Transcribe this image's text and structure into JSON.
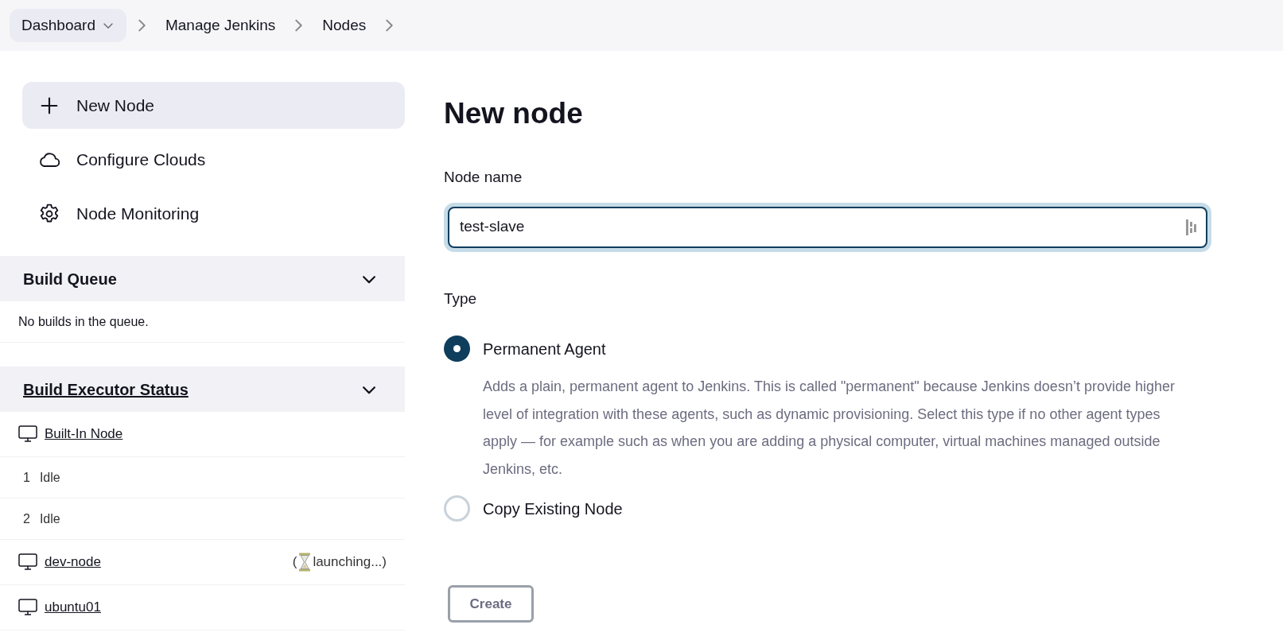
{
  "breadcrumbs": [
    {
      "label": "Dashboard",
      "kind": "dropdown"
    },
    {
      "label": "Manage Jenkins",
      "kind": "link"
    },
    {
      "label": "Nodes",
      "kind": "link"
    }
  ],
  "sidebar": {
    "items": [
      {
        "label": "New Node",
        "kind": "plus",
        "selected": true
      },
      {
        "label": "Configure Clouds",
        "kind": "cloud",
        "selected": false
      },
      {
        "label": "Node Monitoring",
        "kind": "gear",
        "selected": false
      }
    ]
  },
  "build_queue": {
    "title": "Build Queue",
    "expanded": true,
    "empty_text": "No builds in the queue."
  },
  "executor_status": {
    "title": "Build Executor Status",
    "expanded": true,
    "rows": [
      {
        "kind": "node",
        "name": "Built-In Node"
      },
      {
        "kind": "executor",
        "number": "1",
        "status": "Idle"
      },
      {
        "kind": "executor",
        "number": "2",
        "status": "Idle"
      },
      {
        "kind": "node",
        "name": "dev-node",
        "status": "launching...",
        "open": "(",
        "close": ")"
      },
      {
        "kind": "node",
        "name": "ubuntu01"
      }
    ]
  },
  "form": {
    "title": "New node",
    "name_label": "Node name",
    "name_value": "test-slave",
    "type_label": "Type",
    "types": [
      {
        "label": "Permanent Agent",
        "selected": true,
        "description": "Adds a plain, permanent agent to Jenkins. This is called \"permanent\" because Jenkins doesn’t provide higher level of integration with these agents, such as dynamic provisioning. Select this type if no other agent types apply — for example such as when you are adding a physical computer, virtual machines managed outside Jenkins, etc."
      },
      {
        "label": "Copy Existing Node",
        "selected": false
      }
    ],
    "submit": "Create"
  }
}
